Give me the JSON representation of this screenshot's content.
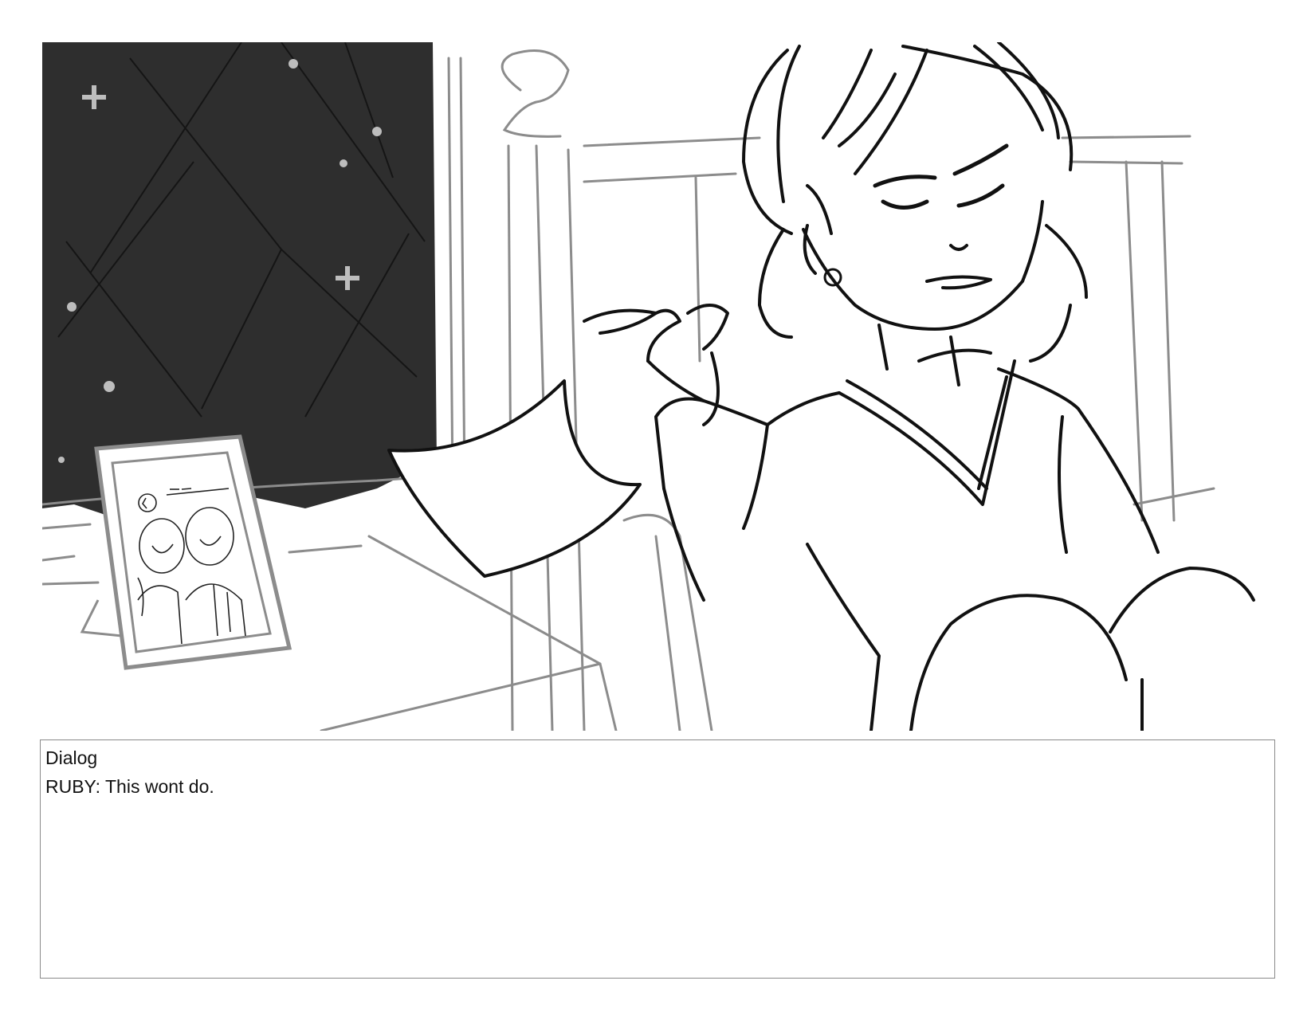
{
  "panel": {
    "description_icons": [
      "night-window",
      "picture-frame",
      "character-ruby",
      "paper-sheet"
    ]
  },
  "dialog": {
    "heading": "Dialog",
    "line": "RUBY: This wont do."
  },
  "colors": {
    "window_fill": "#2e2e2e",
    "line_dark": "#111111",
    "line_gray": "#8c8c8c",
    "border": "#8a8a8a"
  }
}
